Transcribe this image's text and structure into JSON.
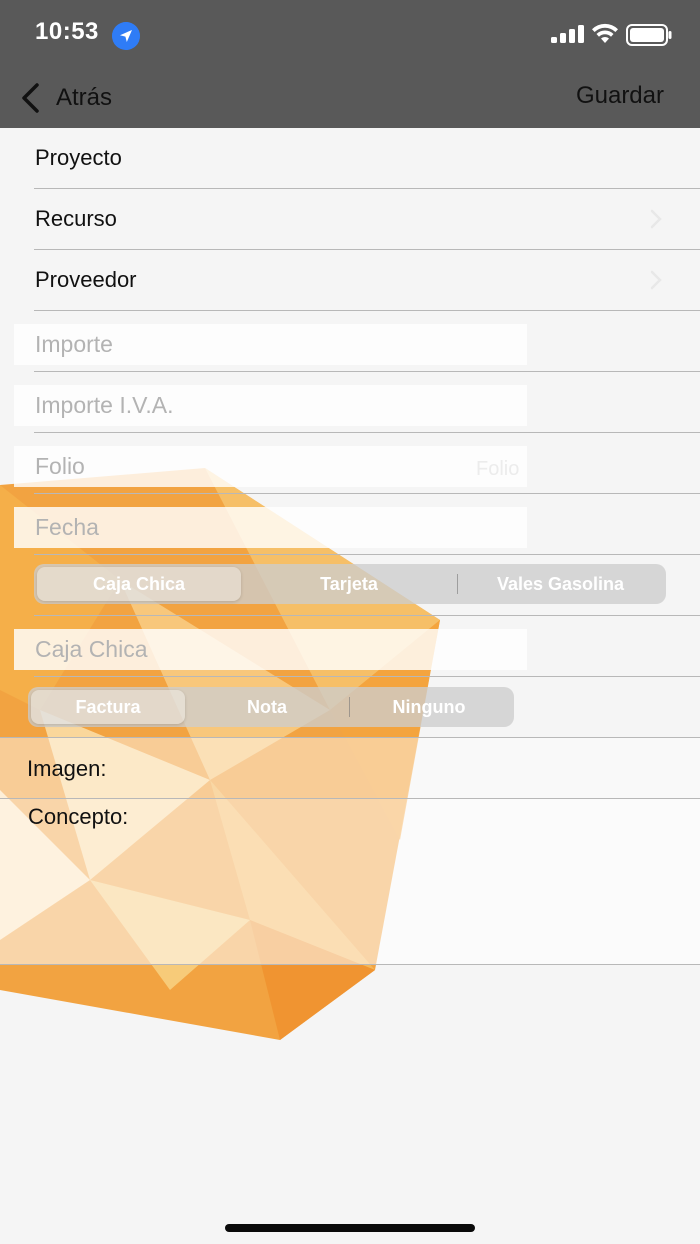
{
  "status_bar": {
    "time": "10:53",
    "icons": [
      "location-arrow-icon",
      "cellular-signal-icon",
      "wifi-icon",
      "battery-icon"
    ]
  },
  "nav": {
    "back_label": "Atrás",
    "save_label": "Guardar"
  },
  "form": {
    "proyecto_label": "Proyecto",
    "recurso_label": "Recurso",
    "proveedor_label": "Proveedor",
    "importe_placeholder": "Importe",
    "importe_iva_placeholder": "Importe I.V.A.",
    "folio_placeholder": "Folio",
    "folio_ghost": "Folio",
    "fecha_placeholder": "Fecha",
    "payment_segments": [
      "Caja Chica",
      "Tarjeta",
      "Vales Gasolina"
    ],
    "payment_selected": "Caja Chica",
    "caja_chica_placeholder": "Caja Chica",
    "document_segments": [
      "Factura",
      "Nota",
      "Ninguno"
    ],
    "document_selected": "Factura",
    "imagen_label": "Imagen:",
    "concepto_label": "Concepto:"
  },
  "colors": {
    "nav_bar": "#595959",
    "background": "#f5f5f5",
    "accent_orange": "#f29a2e",
    "location_blue": "#2f7cf6"
  }
}
